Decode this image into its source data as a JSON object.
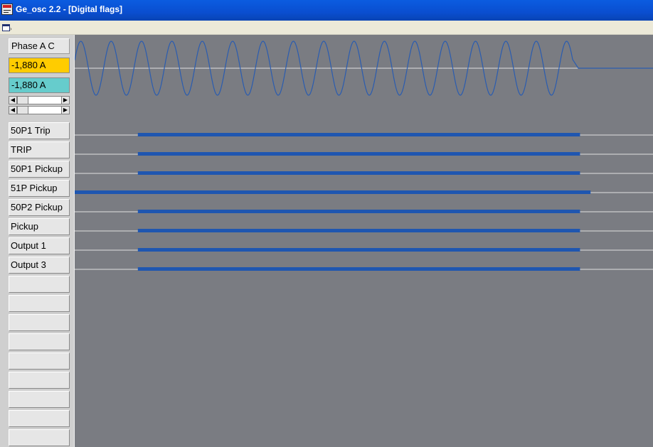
{
  "window": {
    "title": "Ge_osc  2.2 - [Digital flags]"
  },
  "analog_channel": {
    "name": "Phase A C",
    "value_primary": "-1,880 A",
    "value_secondary": "-1,880 A",
    "colors": {
      "primary_bg": "#ffcc00",
      "secondary_bg": "#66cccc",
      "waveform": "#2a5cb0"
    }
  },
  "flags": [
    {
      "label": "50P1 Trip",
      "active_start_fraction": 0.12,
      "active_end_fraction": 0.96
    },
    {
      "label": "TRIP",
      "active_start_fraction": 0.12,
      "active_end_fraction": 0.96
    },
    {
      "label": "50P1 Pickup",
      "active_start_fraction": 0.12,
      "active_end_fraction": 0.96
    },
    {
      "label": "51P Pickup",
      "active_start_fraction": 0.0,
      "active_end_fraction": 0.98
    },
    {
      "label": "50P2 Pickup",
      "active_start_fraction": 0.12,
      "active_end_fraction": 0.96
    },
    {
      "label": "Pickup",
      "active_start_fraction": 0.12,
      "active_end_fraction": 0.96
    },
    {
      "label": "Output 1",
      "active_start_fraction": 0.12,
      "active_end_fraction": 0.96
    },
    {
      "label": "Output 3",
      "active_start_fraction": 0.12,
      "active_end_fraction": 0.96
    }
  ],
  "empty_slot_count": 9,
  "colors": {
    "flag_active": "#1f56b0",
    "baseline": "#e0e0e0",
    "plot_bg": "#7a7c82",
    "title_bar": "#0a4ed0"
  },
  "icons": [
    "app-icon",
    "document-window-icon",
    "arrow-left-icon",
    "arrow-right-icon"
  ]
}
